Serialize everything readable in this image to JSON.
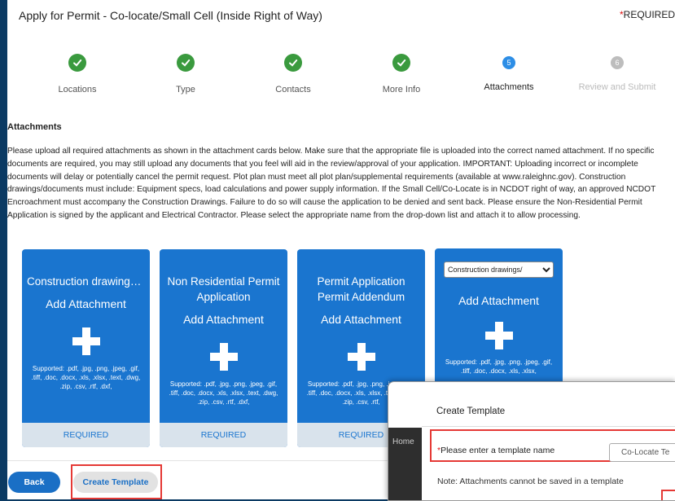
{
  "header": {
    "title": "Apply for Permit - Co-locate/Small Cell (Inside Right of Way)",
    "required_marker": "*",
    "required_text": "REQUIRED"
  },
  "steps": [
    {
      "label": "Locations",
      "status": "complete",
      "icon": "check-icon"
    },
    {
      "label": "Type",
      "status": "complete",
      "icon": "check-icon"
    },
    {
      "label": "Contacts",
      "status": "complete",
      "icon": "check-icon"
    },
    {
      "label": "More Info",
      "status": "complete",
      "icon": "check-icon"
    },
    {
      "label": "Attachments",
      "status": "active",
      "number": "5"
    },
    {
      "label": "Review and Submit",
      "status": "pending",
      "number": "6"
    }
  ],
  "attachments": {
    "heading": "Attachments",
    "intro": "Please upload all required attachments as shown in the attachment cards below. Make sure that the appropriate file is uploaded into the correct named attachment. If no specific documents are required, you may still upload any documents that you feel will aid in the review/approval of your application. IMPORTANT: Uploading incorrect or incomplete documents will delay or potentially cancel the permit request. Plot plan must meet all plot plan/supplemental requirements (available at www.raleighnc.gov). Construction drawings/documents must include: Equipment specs, load calculations and power supply information. If the Small Cell/Co-Locate is in NCDOT right of way, an approved NCDOT Encroachment must accompany the Construction Drawings. Failure to do so will cause the application to be denied and sent back. Please ensure the Non-Residential Permit Application is signed by the applicant and Electrical Contractor. Please select the appropriate name from the drop-down list and attach it to allow processing.",
    "cards": [
      {
        "title": "Construction drawings/documen..",
        "add_label": "Add Attachment",
        "supported": "Supported: .pdf, .jpg, .png, .jpeg, .gif, .tiff, .doc, .docx, .xls, .xlsx, .text, .dwg, .zip, .csv, .rtf, .dxf,",
        "required_label": "REQUIRED"
      },
      {
        "title": "Non Residential Permit Application",
        "add_label": "Add Attachment",
        "supported": "Supported: .pdf, .jpg, .png, .jpeg, .gif, .tiff, .doc, .docx, .xls, .xlsx, .text, .dwg, .zip, .csv, .rtf, .dxf,",
        "required_label": "REQUIRED"
      },
      {
        "title": "Permit Application Permit Addendum",
        "add_label": "Add Attachment",
        "supported": "Supported: .pdf, .jpg, .png, .jpeg, .gif, .tiff, .doc, .docx, .xls, .xlsx, .text, .dwg, .zip, .csv, .rtf,",
        "required_label": "REQUIRED"
      }
    ],
    "custom_card": {
      "select_value": "Construction drawings/",
      "add_label": "Add Attachment",
      "supported": "Supported: .pdf, .jpg, .png, .jpeg, .gif, .tiff, .doc, .docx, .xls, .xlsx,"
    }
  },
  "footer": {
    "back_label": "Back",
    "create_template_label": "Create Template"
  },
  "modal": {
    "title": "Create Template",
    "side_label": "Home",
    "name_label": "Please enter a template name",
    "name_required_marker": "*",
    "name_value": "Co-Locate Te",
    "note": "Note: Attachments cannot be saved in a template"
  },
  "colors": {
    "card_blue": "#1a75cf",
    "complete_green": "#3a9a3e",
    "active_blue": "#2d8ee6",
    "highlight_red": "#e53935"
  }
}
